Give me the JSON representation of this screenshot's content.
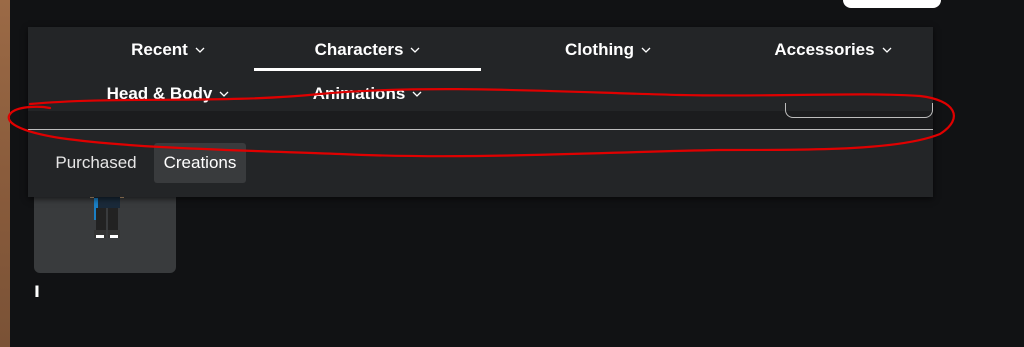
{
  "categories": {
    "recent": "Recent",
    "characters": "Characters",
    "clothing": "Clothing",
    "accessories": "Accessories",
    "head_body": "Head & Body",
    "animations": "Animations"
  },
  "active_category": "Characters",
  "subtabs": {
    "purchased": "Purchased",
    "creations": "Creations"
  },
  "active_subtab": "Creations",
  "avatar_card": {
    "caption": "I"
  },
  "colors": {
    "page_bg": "#111214",
    "panel_bg": "#232527",
    "selected_tab_bg": "#393b3d",
    "annotation": "#e00000"
  },
  "icons": {
    "chevron": "chevron-down-icon"
  }
}
